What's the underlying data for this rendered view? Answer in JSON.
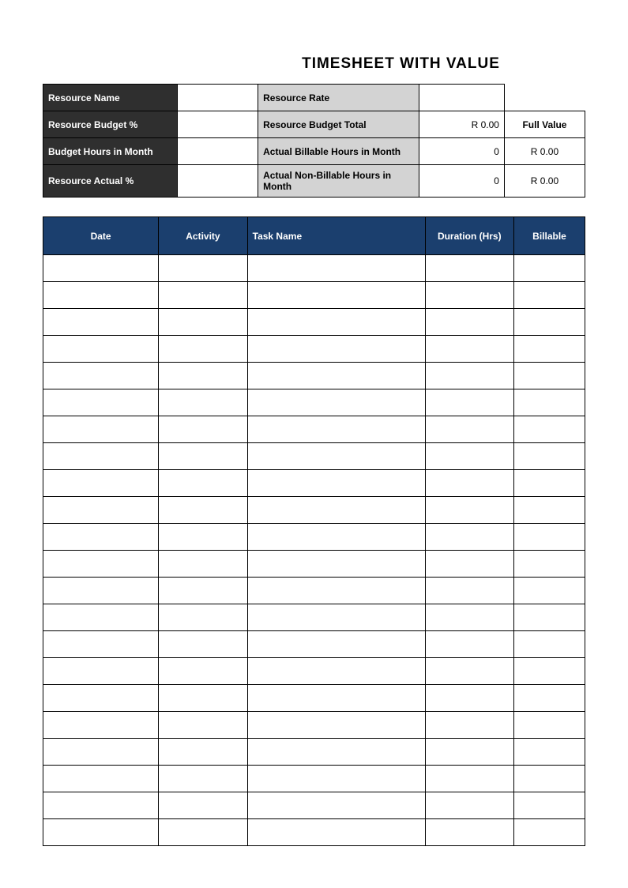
{
  "title": "TIMESHEET WITH VALUE",
  "summary": {
    "row1": {
      "label_a": "Resource Name",
      "val_a": "",
      "label_b": "Resource Rate",
      "val_b": ""
    },
    "row2": {
      "label_a": "Resource Budget %",
      "val_a": "",
      "label_b": "Resource Budget Total",
      "val_b": "R 0.00",
      "side": "Full Value"
    },
    "row3": {
      "label_a": "Budget Hours in Month",
      "val_a": "",
      "label_b": "Actual Billable Hours in Month",
      "val_b": "0",
      "side": "R 0.00"
    },
    "row4": {
      "label_a": "Resource Actual %",
      "val_a": "",
      "label_b": "Actual Non-Billable Hours in Month",
      "val_b": "0",
      "side": "R 0.00"
    }
  },
  "columns": {
    "date": "Date",
    "activity": "Activity",
    "task": "Task Name",
    "duration": "Duration (Hrs)",
    "billable": "Billable"
  },
  "rows": [
    {
      "date": "",
      "activity": "",
      "task": "",
      "duration": "",
      "billable": ""
    },
    {
      "date": "",
      "activity": "",
      "task": "",
      "duration": "",
      "billable": ""
    },
    {
      "date": "",
      "activity": "",
      "task": "",
      "duration": "",
      "billable": ""
    },
    {
      "date": "",
      "activity": "",
      "task": "",
      "duration": "",
      "billable": ""
    },
    {
      "date": "",
      "activity": "",
      "task": "",
      "duration": "",
      "billable": ""
    },
    {
      "date": "",
      "activity": "",
      "task": "",
      "duration": "",
      "billable": ""
    },
    {
      "date": "",
      "activity": "",
      "task": "",
      "duration": "",
      "billable": ""
    },
    {
      "date": "",
      "activity": "",
      "task": "",
      "duration": "",
      "billable": ""
    },
    {
      "date": "",
      "activity": "",
      "task": "",
      "duration": "",
      "billable": ""
    },
    {
      "date": "",
      "activity": "",
      "task": "",
      "duration": "",
      "billable": ""
    },
    {
      "date": "",
      "activity": "",
      "task": "",
      "duration": "",
      "billable": ""
    },
    {
      "date": "",
      "activity": "",
      "task": "",
      "duration": "",
      "billable": ""
    },
    {
      "date": "",
      "activity": "",
      "task": "",
      "duration": "",
      "billable": ""
    },
    {
      "date": "",
      "activity": "",
      "task": "",
      "duration": "",
      "billable": ""
    },
    {
      "date": "",
      "activity": "",
      "task": "",
      "duration": "",
      "billable": ""
    },
    {
      "date": "",
      "activity": "",
      "task": "",
      "duration": "",
      "billable": ""
    },
    {
      "date": "",
      "activity": "",
      "task": "",
      "duration": "",
      "billable": ""
    },
    {
      "date": "",
      "activity": "",
      "task": "",
      "duration": "",
      "billable": ""
    },
    {
      "date": "",
      "activity": "",
      "task": "",
      "duration": "",
      "billable": ""
    },
    {
      "date": "",
      "activity": "",
      "task": "",
      "duration": "",
      "billable": ""
    },
    {
      "date": "",
      "activity": "",
      "task": "",
      "duration": "",
      "billable": ""
    },
    {
      "date": "",
      "activity": "",
      "task": "",
      "duration": "",
      "billable": ""
    }
  ]
}
